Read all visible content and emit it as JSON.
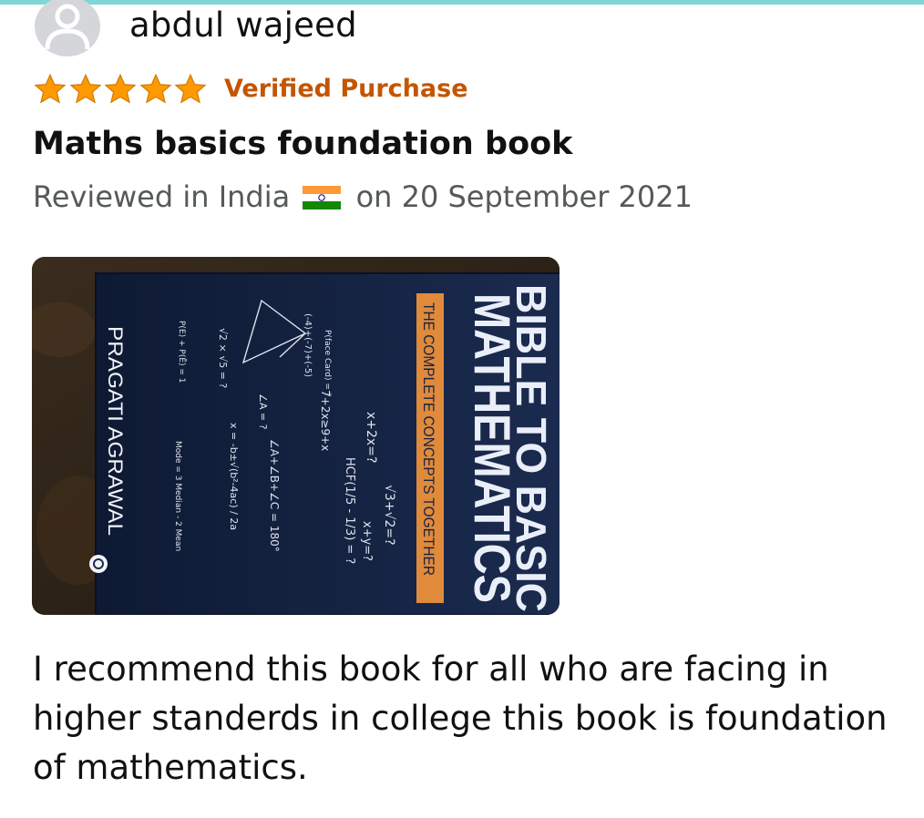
{
  "reviewer": {
    "name": "abdul wajeed",
    "avatar_icon": "person-icon"
  },
  "rating": {
    "stars": 5,
    "max": 5,
    "star_color": "#ff9900",
    "badge": "Verified Purchase",
    "badge_color": "#c45500"
  },
  "review": {
    "title": "Maths basics foundation book",
    "reviewed_prefix": "Reviewed in India",
    "flag_icon": "india-flag-icon",
    "reviewed_suffix": "on 20 September 2021",
    "body": "I recommend this book for all who are facing in higher standerds in college this book is foundation of mathematics."
  },
  "photo": {
    "book_title_line1": "BIBLE TO BASIC",
    "book_title_line2": "MATHEMATICS",
    "book_subtitle": "THE COMPLETE CONCEPTS TOGETHER",
    "author": "PRAGATI AGRAWAL",
    "formulas": [
      "√3+√2=?",
      "x+2x=?",
      "P(face Card) = ?",
      "HCF(1/5 - 1/3) = ?",
      "7+2x≥9+x",
      "(-4)+(-7)+(-5)",
      "x+y=?",
      "∠A+∠B+∠C = 180°",
      "∠A = ?",
      "x = -b±√(b²-4ac) / 2a",
      "√2 × √5 = ?",
      "Mode = 3 Median - 2 Mean",
      "P(E) + P(Ē) = 1"
    ]
  }
}
